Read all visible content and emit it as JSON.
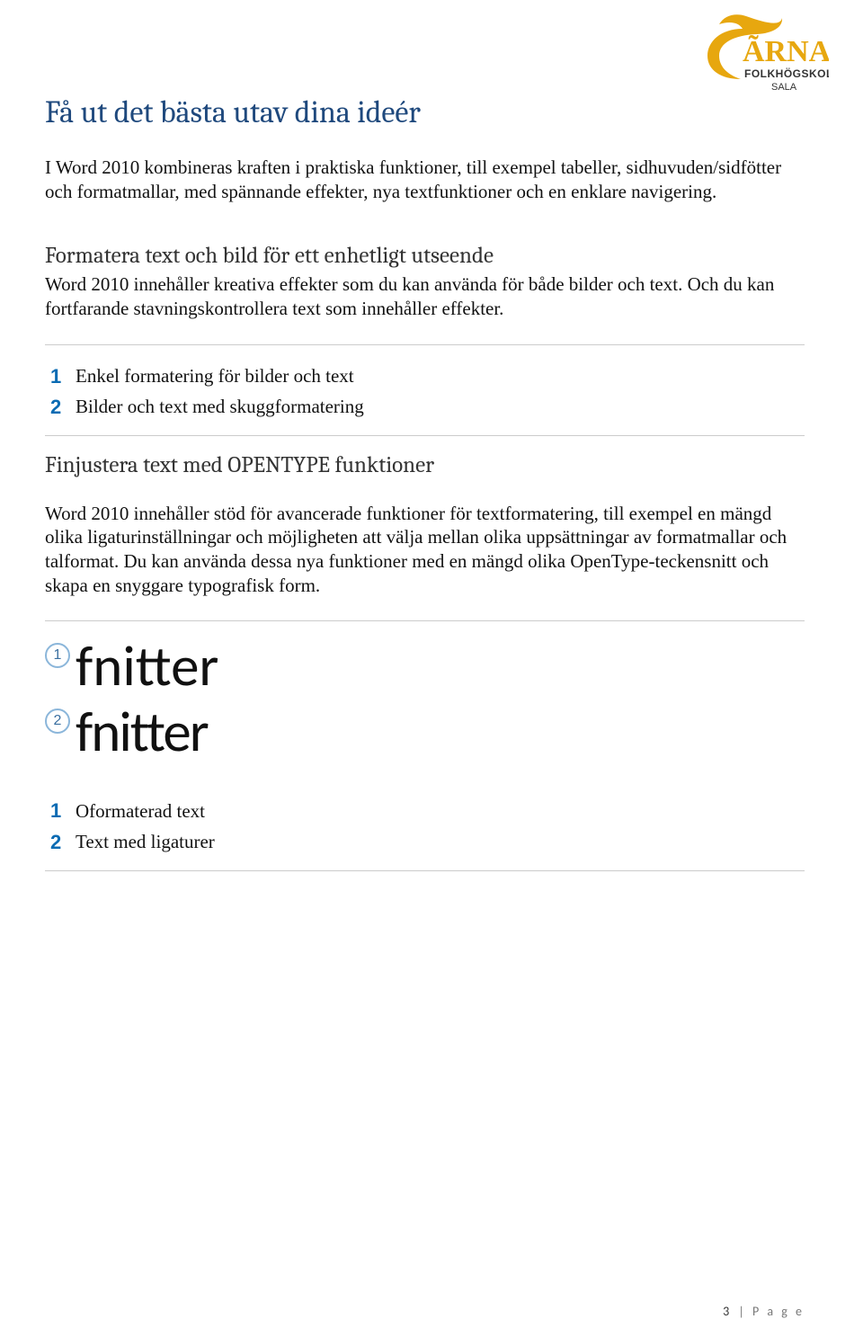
{
  "logo": {
    "brand": "ÃRNA",
    "line1": "FOLKHÖGSKOLA",
    "line2": "SALA",
    "color_main": "#e7a70f",
    "color_text": "#333"
  },
  "title": "Få ut det bästa utav dina ideér",
  "intro": "I Word 2010 kombineras kraften i praktiska funktioner, till exempel tabeller, sidhuvuden/sidfötter och formatmallar, med spännande effekter, nya textfunktioner och en enklare navigering.",
  "section1": {
    "heading": "Formatera text och bild för ett enhetligt utseende",
    "body": "Word 2010 innehåller kreativa effekter som du kan använda för både bilder och text. Och du kan fortfarande stavningskontrollera text som innehåller effekter.",
    "list": [
      "Enkel formatering för bilder och text",
      "Bilder och text med skuggformatering"
    ]
  },
  "section2": {
    "heading": "Finjustera text med OPENTYPE funktioner",
    "body": "Word 2010 innehåller stöd för avancerade funktioner för textformatering, till exempel en mängd olika ligaturinställningar och möjligheten att välja mellan olika uppsättningar av formatmallar och talformat. Du kan använda dessa nya funktioner med en mängd olika OpenType-teckensnitt och skapa en snyggare typografisk form.",
    "example_word": "fnitter",
    "legend": [
      "Oformaterad text",
      "Text med ligaturer"
    ]
  },
  "footer": {
    "page_number": "3",
    "label": "P a g e",
    "sep": "|"
  }
}
